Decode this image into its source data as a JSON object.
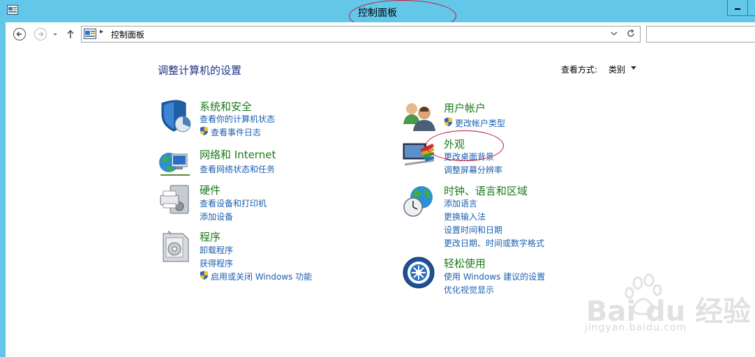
{
  "window": {
    "title": "控制面板"
  },
  "address": {
    "crumb": "控制面板",
    "separator": "▸"
  },
  "main": {
    "heading": "调整计算机的设置",
    "view_by_label": "查看方式:",
    "view_by_value": "类别"
  },
  "categories": [
    {
      "title": "系统和安全",
      "icon": "shield-security-icon",
      "links": [
        {
          "text": "查看你的计算机状态",
          "shield": false
        },
        {
          "text": "查看事件日志",
          "shield": true
        }
      ]
    },
    {
      "title": "网络和 Internet",
      "icon": "network-globe-icon",
      "links": [
        {
          "text": "查看网络状态和任务",
          "shield": false
        }
      ]
    },
    {
      "title": "硬件",
      "icon": "printer-hardware-icon",
      "links": [
        {
          "text": "查看设备和打印机",
          "shield": false
        },
        {
          "text": "添加设备",
          "shield": false
        }
      ]
    },
    {
      "title": "程序",
      "icon": "programs-box-icon",
      "links": [
        {
          "text": "卸载程序",
          "shield": false
        },
        {
          "text": "获得程序",
          "shield": false
        },
        {
          "text": "启用或关闭 Windows 功能",
          "shield": true
        }
      ]
    },
    {
      "title": "用户帐户",
      "icon": "user-accounts-icon",
      "links": [
        {
          "text": "更改帐户类型",
          "shield": true
        }
      ]
    },
    {
      "title": "外观",
      "icon": "appearance-display-icon",
      "links": [
        {
          "text": "更改桌面背景",
          "shield": false
        },
        {
          "text": "调整屏幕分辨率",
          "shield": false
        }
      ]
    },
    {
      "title": "时钟、语言和区域",
      "icon": "clock-globe-icon",
      "links": [
        {
          "text": "添加语言",
          "shield": false
        },
        {
          "text": "更换输入法",
          "shield": false
        },
        {
          "text": "设置时间和日期",
          "shield": false
        },
        {
          "text": "更改日期、时间或数字格式",
          "shield": false
        }
      ]
    },
    {
      "title": "轻松使用",
      "icon": "ease-of-access-icon",
      "links": [
        {
          "text": "使用 Windows 建议的设置",
          "shield": false
        },
        {
          "text": "优化视觉显示",
          "shield": false
        }
      ]
    }
  ],
  "watermark": {
    "logo": "Bai du 经验",
    "url": "jingyan.baidu.com"
  },
  "colors": {
    "titlebar": "#63c7ea",
    "heading": "#1e3287",
    "category_title": "#1a7a1a",
    "link": "#1c5fb0",
    "annotation": "#c8102e"
  }
}
